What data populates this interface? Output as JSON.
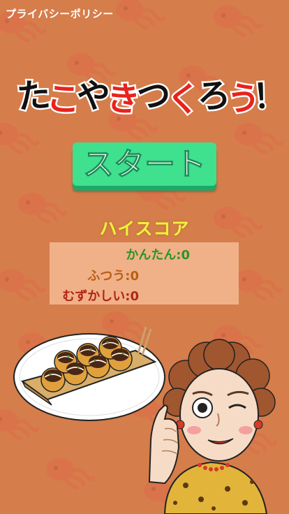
{
  "privacy_link": "プライバシーポリシー",
  "title_chars": [
    {
      "char": "た",
      "color": "#111111"
    },
    {
      "char": "こ",
      "color": "#e8231c"
    },
    {
      "char": "や",
      "color": "#111111"
    },
    {
      "char": "き",
      "color": "#e8231c"
    },
    {
      "char": "つ",
      "color": "#111111"
    },
    {
      "char": "く",
      "color": "#e8231c"
    },
    {
      "char": "ろ",
      "color": "#111111"
    },
    {
      "char": "う",
      "color": "#e8231c"
    },
    {
      "char": "！",
      "color": "#111111"
    }
  ],
  "start_button": "スタート",
  "highscore": {
    "title": "ハイスコア",
    "rows": [
      {
        "label": "かんたん",
        "score": "0",
        "color": "#2d9424"
      },
      {
        "label": "ふつう",
        "score": "0",
        "color": "#b85e16"
      },
      {
        "label": "むずかしい",
        "score": "0",
        "color": "#b0251a"
      }
    ],
    "separator": ":"
  },
  "colors": {
    "background": "#d57d4b",
    "button": "#3fe08e",
    "highscore_title": "#eff33a"
  }
}
